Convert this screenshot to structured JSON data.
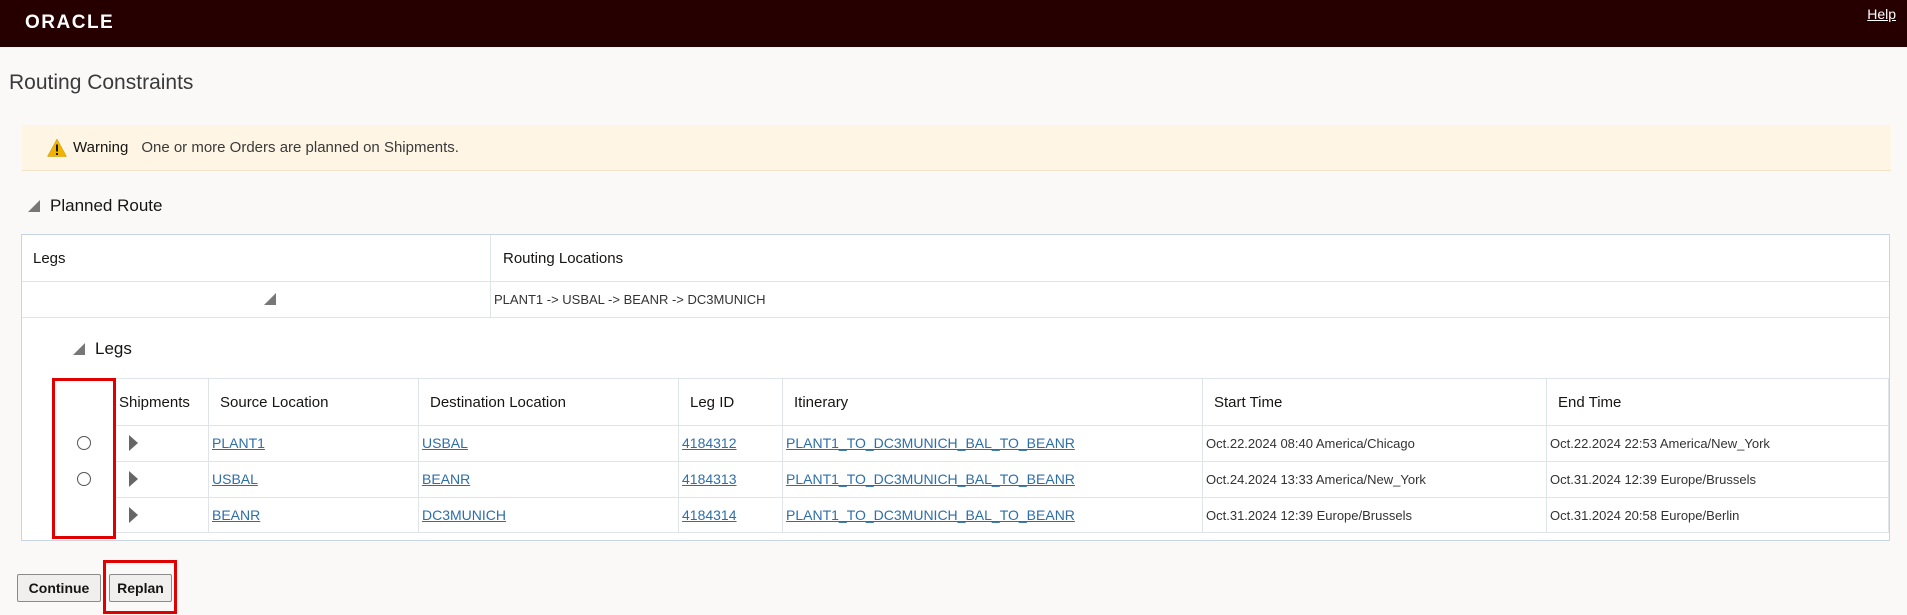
{
  "header": {
    "logo": "ORACLE",
    "help_label": "Help"
  },
  "page": {
    "title": "Routing Constraints"
  },
  "warning": {
    "label": "Warning",
    "message": "One or more Orders are planned on Shipments."
  },
  "planned_route": {
    "section_title": "Planned Route",
    "columns": [
      "Legs",
      "Routing Locations"
    ],
    "row": {
      "routing_locations": "PLANT1 -> USBAL -> BEANR -> DC3MUNICH"
    }
  },
  "legs": {
    "section_title": "Legs",
    "columns": [
      "Shipments",
      "Source Location",
      "Destination Location",
      "Leg ID",
      "Itinerary",
      "Start Time",
      "End Time"
    ],
    "rows": [
      {
        "source": "PLANT1",
        "destination": "USBAL",
        "leg_id": "4184312",
        "itinerary": "PLANT1_TO_DC3MUNICH_BAL_TO_BEANR",
        "start_time": "Oct.22.2024 08:40 America/Chicago",
        "end_time": "Oct.22.2024 22:53 America/New_York"
      },
      {
        "source": "USBAL",
        "destination": "BEANR",
        "leg_id": "4184313",
        "itinerary": "PLANT1_TO_DC3MUNICH_BAL_TO_BEANR",
        "start_time": "Oct.24.2024 13:33 America/New_York",
        "end_time": "Oct.31.2024 12:39 Europe/Brussels"
      },
      {
        "source": "BEANR",
        "destination": "DC3MUNICH",
        "leg_id": "4184314",
        "itinerary": "PLANT1_TO_DC3MUNICH_BAL_TO_BEANR",
        "start_time": "Oct.31.2024 12:39 Europe/Brussels",
        "end_time": "Oct.31.2024 20:58 Europe/Berlin"
      }
    ]
  },
  "buttons": {
    "continue_label": "Continue",
    "replan_label": "Replan"
  },
  "colors": {
    "topbar": "#260000",
    "warning_bg": "#fef5e4",
    "link": "#2d6ea9",
    "highlight": "#e00000"
  }
}
